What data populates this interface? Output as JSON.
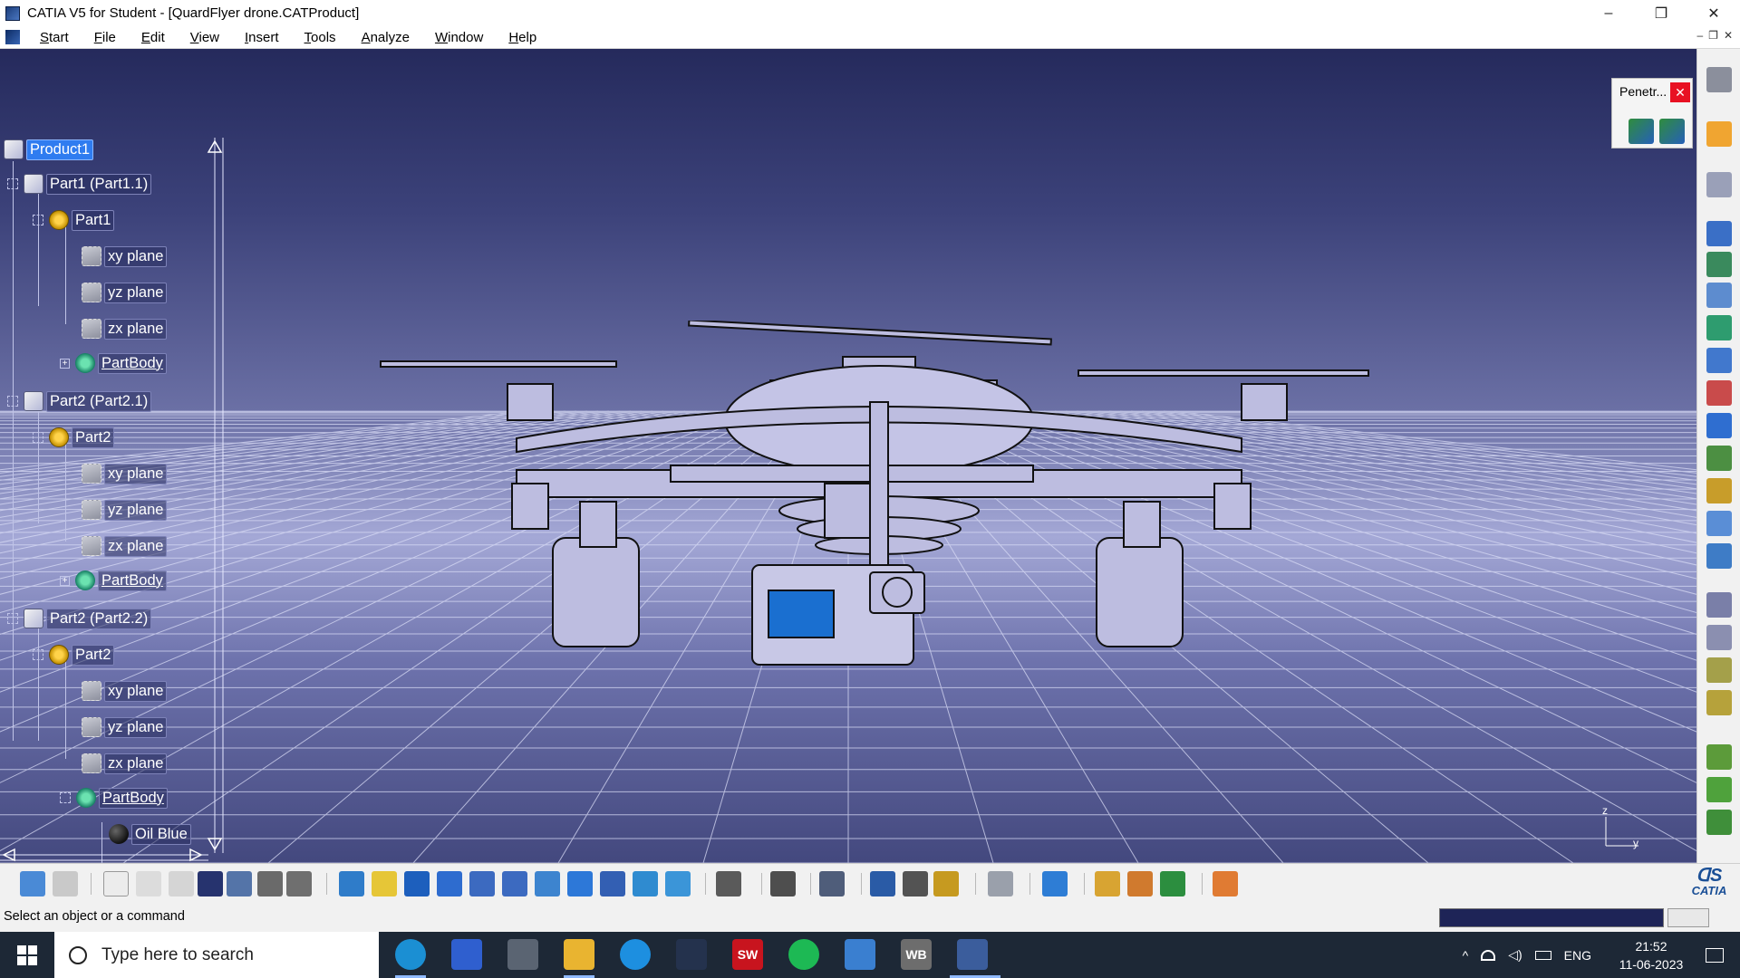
{
  "window": {
    "title": "CATIA V5 for Student - [QuardFlyer drone.CATProduct]",
    "controls": [
      "–",
      "❐",
      "✕"
    ]
  },
  "menu": [
    "Start",
    "File",
    "Edit",
    "View",
    "Insert",
    "Tools",
    "Analyze",
    "Window",
    "Help"
  ],
  "tree": {
    "root": "Product1",
    "nodes": [
      {
        "label": "Part1 (Part1.1)",
        "kind": "product"
      },
      {
        "label": "Part1",
        "kind": "part"
      },
      {
        "label": "xy plane",
        "kind": "plane"
      },
      {
        "label": "yz plane",
        "kind": "plane"
      },
      {
        "label": "zx plane",
        "kind": "plane"
      },
      {
        "label": "PartBody",
        "kind": "body"
      },
      {
        "label": "Part2 (Part2.1)",
        "kind": "product"
      },
      {
        "label": "Part2",
        "kind": "part"
      },
      {
        "label": "xy plane",
        "kind": "plane"
      },
      {
        "label": "yz plane",
        "kind": "plane"
      },
      {
        "label": "zx plane",
        "kind": "plane"
      },
      {
        "label": "PartBody",
        "kind": "body"
      },
      {
        "label": "Part2 (Part2.2)",
        "kind": "product"
      },
      {
        "label": "Part2",
        "kind": "part"
      },
      {
        "label": "xy plane",
        "kind": "plane"
      },
      {
        "label": "yz plane",
        "kind": "plane"
      },
      {
        "label": "zx plane",
        "kind": "plane"
      },
      {
        "label": "PartBody",
        "kind": "body"
      },
      {
        "label": "Oil Blue",
        "kind": "material"
      }
    ]
  },
  "penetration_panel": {
    "title": "Penetr...",
    "close": "✕"
  },
  "axis_triad": {
    "z": "z",
    "y": "y"
  },
  "status": {
    "message": "Select an object or a command"
  },
  "brand": {
    "logo_text": "CATIA"
  },
  "taskbar": {
    "search_placeholder": "Type here to search",
    "apps": [
      "edge",
      "autodesk",
      "cube-app",
      "file-explorer",
      "skype",
      "catia",
      "solidworks",
      "spotify",
      "store",
      "workbench",
      "catia-active"
    ],
    "solidworks_label": "SW",
    "workbench_label": "WB",
    "language": "ENG",
    "time": "21:52",
    "date": "11-06-2023"
  },
  "colors": {
    "viewport_top": "#252a5c",
    "viewport_mid": "#a4a8d6",
    "selection": "#2f7cf0",
    "drone_body": "#bdbde0",
    "camera_screen": "#1a6fd0"
  }
}
